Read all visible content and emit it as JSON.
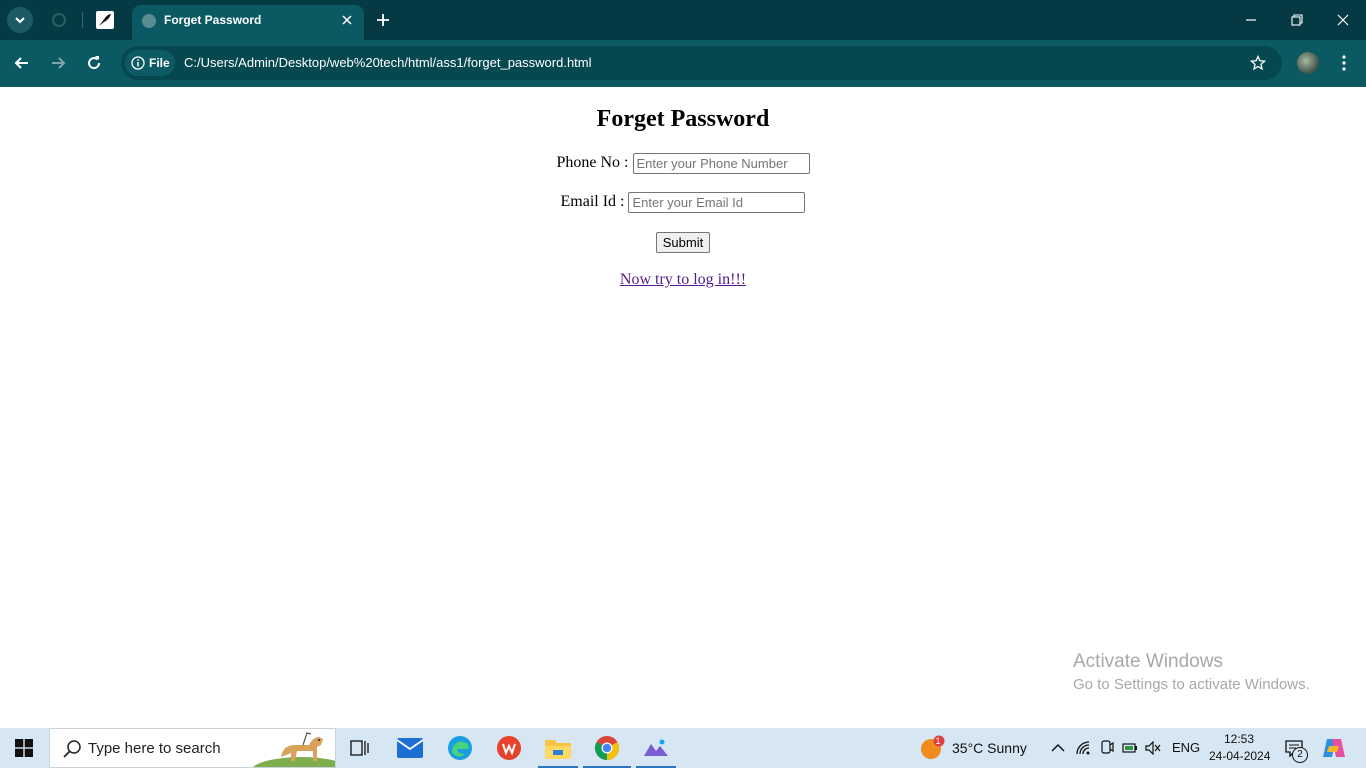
{
  "browser": {
    "active_tab_title": "Forget Password",
    "omnibox_chip": "File",
    "url": "C:/Users/Admin/Desktop/web%20tech/html/ass1/forget_password.html"
  },
  "page": {
    "heading": "Forget Password",
    "phone_label": "Phone No : ",
    "phone_placeholder": "Enter your Phone Number",
    "email_label": "Email Id : ",
    "email_placeholder": "Enter your Email Id",
    "submit_label": "Submit",
    "login_link": "Now try to log in!!!"
  },
  "watermark": {
    "line1": "Activate Windows",
    "line2": "Go to Settings to activate Windows."
  },
  "taskbar": {
    "search_placeholder": "Type here to search",
    "weather_badge": "1",
    "weather": "35°C  Sunny",
    "language": "ENG",
    "time": "12:53",
    "date": "24-04-2024",
    "notification_count": "2"
  },
  "colors": {
    "tabstrip": "#053a44",
    "toolbar": "#0b5a63",
    "link_visited": "#551a8b",
    "taskbar": "#d6e6f2"
  }
}
